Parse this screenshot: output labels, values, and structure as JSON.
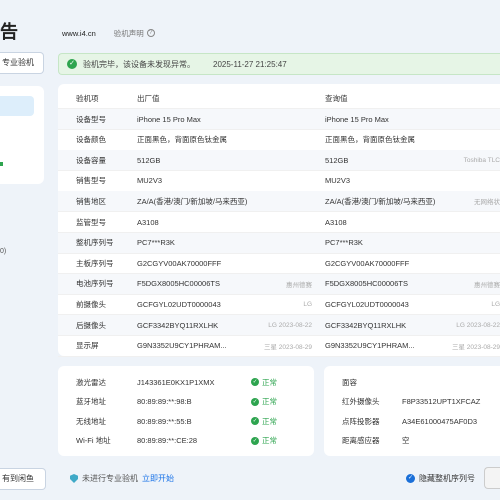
{
  "left": {
    "title_fragment": "告",
    "pro_button": "专业验机",
    "number_fragment": "0)",
    "bottom_button": "有到闲鱼"
  },
  "topbar": {
    "site": "www.i4.cn",
    "disclaimer": "验机声明"
  },
  "banner": {
    "text": "验机完毕，该设备未发现异常。",
    "time": "2025-11-27 21:25:47"
  },
  "table": {
    "header": {
      "label": "验机项",
      "factory": "出厂值",
      "query": "查询值"
    },
    "rows": [
      {
        "label": "设备型号",
        "factory": "iPhone 15 Pro Max",
        "fnote": "",
        "query": "iPhone 15 Pro Max",
        "qnote": ""
      },
      {
        "label": "设备颜色",
        "factory": "正面黑色，背面原色钛金属",
        "fnote": "",
        "query": "正面黑色，背面原色钛金属",
        "qnote": ""
      },
      {
        "label": "设备容量",
        "factory": "512GB",
        "fnote": "",
        "query": "512GB",
        "qnote": "Toshiba TLC"
      },
      {
        "label": "销售型号",
        "factory": "MU2V3",
        "fnote": "",
        "query": "MU2V3",
        "qnote": ""
      },
      {
        "label": "销售地区",
        "factory": "ZA/A(香港/澳门/新加坡/马来西亚)",
        "fnote": "",
        "query": "ZA/A(香港/澳门/新加坡/马来西亚)",
        "qnote": "无网络状"
      },
      {
        "label": "监管型号",
        "factory": "A3108",
        "fnote": "",
        "query": "A3108",
        "qnote": ""
      },
      {
        "label": "整机序列号",
        "factory": "PC7***R3K",
        "fnote": "",
        "query": "PC7***R3K",
        "qnote": ""
      },
      {
        "label": "主板序列号",
        "factory": "G2CGYV00AK70000FFF",
        "fnote": "",
        "query": "G2CGYV00AK70000FFF",
        "qnote": ""
      },
      {
        "label": "电池序列号",
        "factory": "F5DGX8005HC00006TS",
        "fnote": "惠州德赛",
        "query": "F5DGX8005HC00006TS",
        "qnote": "惠州德赛"
      },
      {
        "label": "前摄像头",
        "factory": "GCFGYL02UDT0000043",
        "fnote": "LG",
        "query": "GCFGYL02UDT0000043",
        "qnote": "LG"
      },
      {
        "label": "后摄像头",
        "factory": "GCF3342BYQ11RXLHK",
        "fnote": "LG 2023-08-22",
        "query": "GCF3342BYQ11RXLHK",
        "qnote": "LG 2023-08-22"
      },
      {
        "label": "显示屏",
        "factory": "G9N3352U9CY1PHRAM...",
        "fnote": "三星 2023-08-29",
        "query": "G9N3352U9CY1PHRAM...",
        "qnote": "三星 2023-08-29"
      }
    ]
  },
  "bottom_left": [
    {
      "label": "激光雷达",
      "value": "J143361E0KX1P1XMX",
      "status": "正常"
    },
    {
      "label": "蓝牙地址",
      "value": "80:89:89:**:98:B",
      "status": "正常"
    },
    {
      "label": "无线地址",
      "value": "80:89:89:**:55:B",
      "status": "正常"
    },
    {
      "label": "Wi-Fi 地址",
      "value": "80:89:89:**:CE:28",
      "status": "正常"
    }
  ],
  "bottom_right": [
    {
      "label": "面容",
      "value": ""
    },
    {
      "label": "红外摄像头",
      "value": "F8P33512UPT1XFCAZ"
    },
    {
      "label": "点阵投影器",
      "value": "A34E61000475AF0D3"
    },
    {
      "label": "距离感应器",
      "value": "空"
    }
  ],
  "footer": {
    "left_text": "未进行专业验机",
    "link": "立即开始",
    "right_text": "隐藏整机序列号"
  },
  "colors": {
    "accent": "#1a73e8",
    "success": "#2ea44f",
    "banner_bg": "#e6f5e6"
  }
}
